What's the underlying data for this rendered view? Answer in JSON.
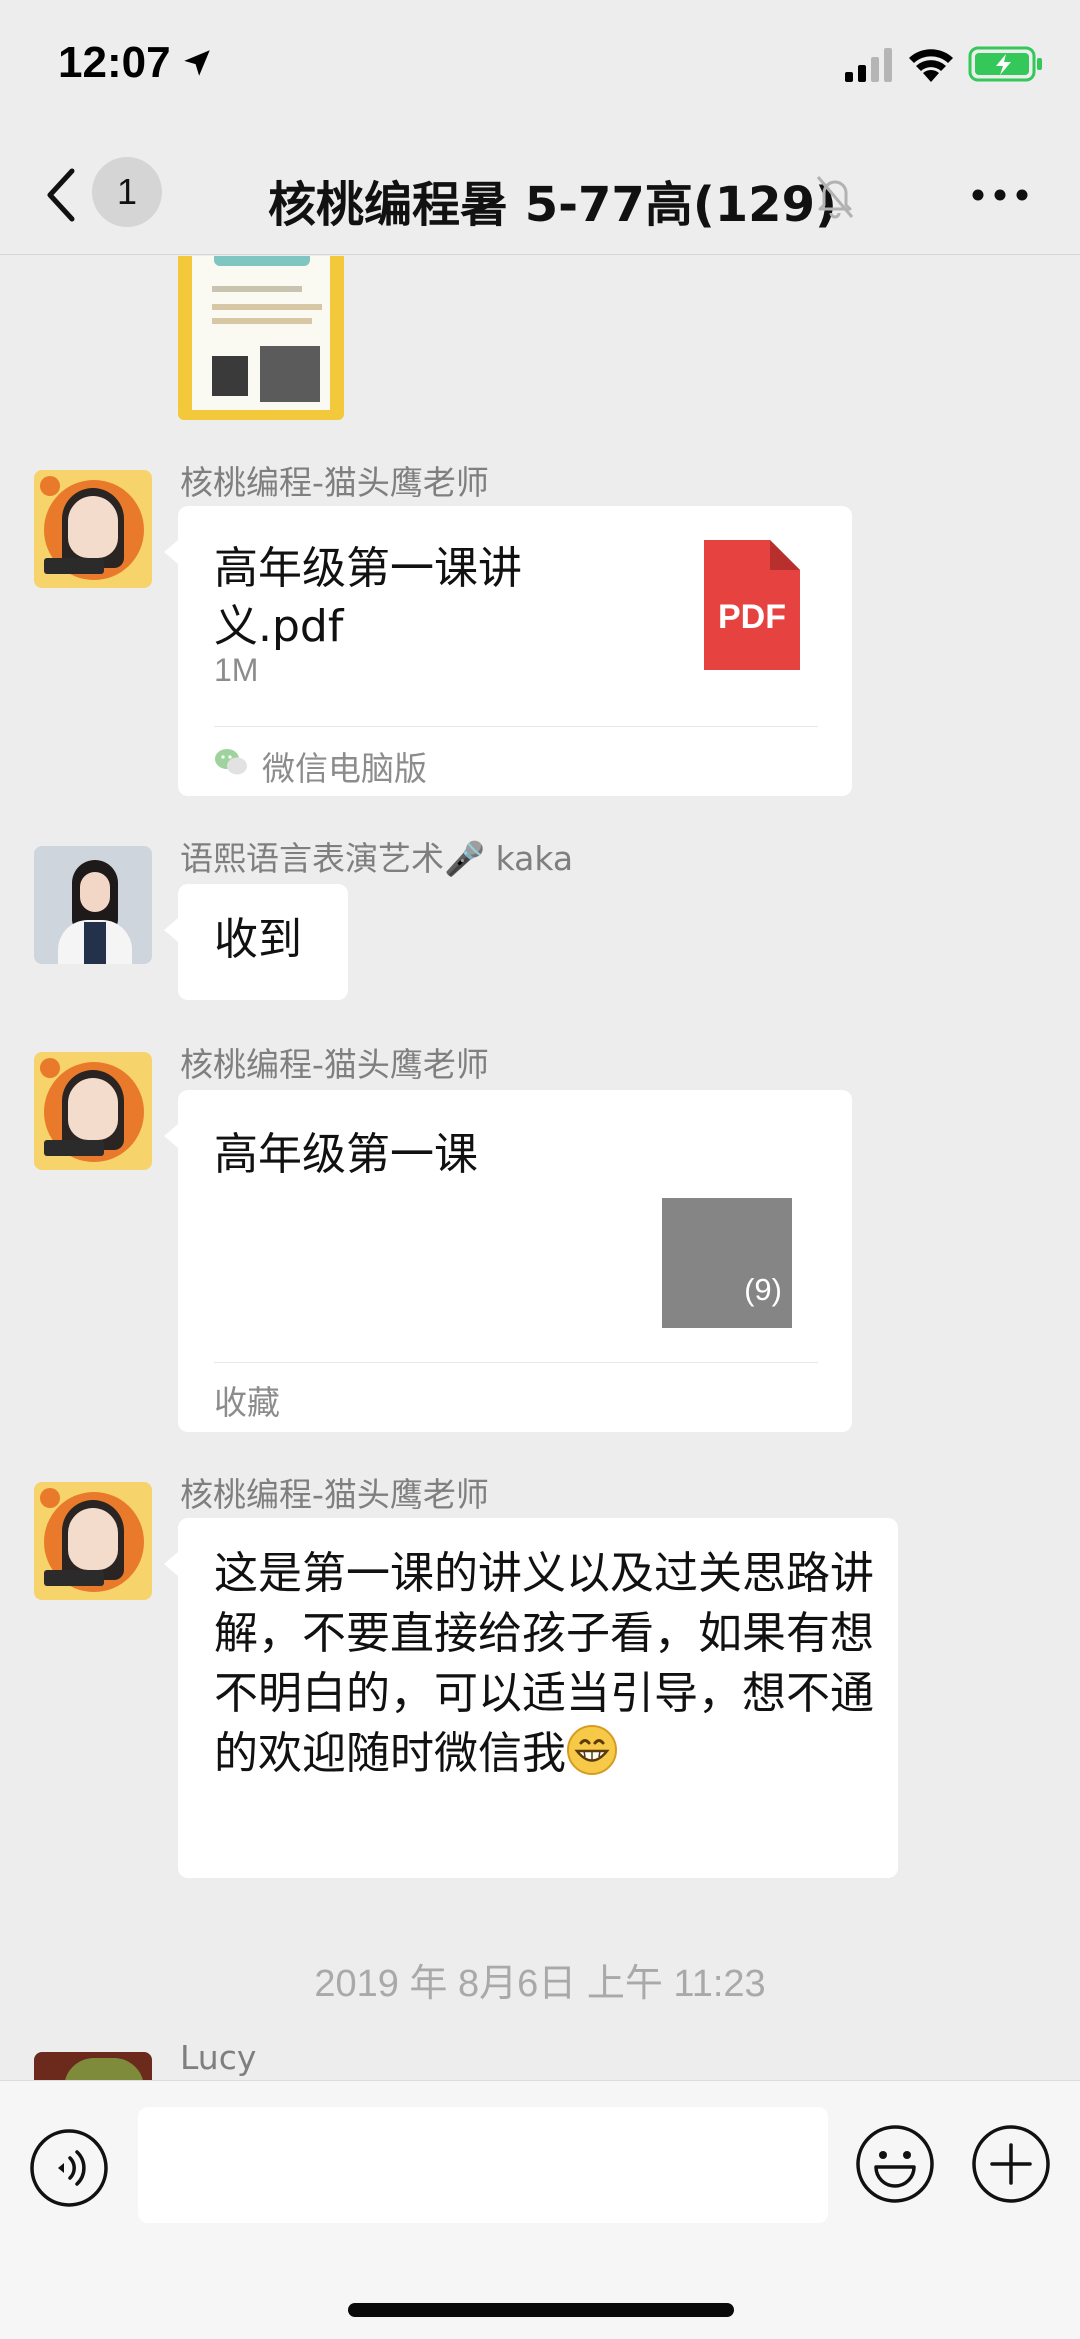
{
  "status": {
    "time": "12:07",
    "battery_color": "#34c759"
  },
  "header": {
    "unread_count": "1",
    "title": "核桃编程暑 5-77高(129)"
  },
  "messages": [
    {
      "type": "image",
      "sender": ""
    },
    {
      "type": "file",
      "sender": "核桃编程-猫头鹰老师",
      "file_name": "高年级第一课讲义.pdf",
      "file_size": "1M",
      "file_type": "PDF",
      "source": "微信电脑版"
    },
    {
      "type": "text",
      "sender": "语熙语言表演艺术🎤 kaka",
      "text": "收到"
    },
    {
      "type": "favorite",
      "sender": "核桃编程-猫头鹰老师",
      "title": "高年级第一课",
      "count": "(9)",
      "label": "收藏"
    },
    {
      "type": "text",
      "sender": "核桃编程-猫头鹰老师",
      "text": "这是第一课的讲义以及过关思路讲解，不要直接给孩子看，如果有想不明白的，可以适当引导，想不通的欢迎随时微信我"
    }
  ],
  "timestamp": "2019 年 8月6日 上午 11:23",
  "last_sender": "Lucy",
  "input": {
    "value": "",
    "placeholder": ""
  },
  "colors": {
    "background": "#ededed",
    "bubble": "#ffffff",
    "pdf_red": "#e64340",
    "name_gray": "#7f7f7f"
  },
  "icons": {
    "back": "chevron-left-icon",
    "mute": "bell-slash-icon",
    "more": "more-dots-icon",
    "voice": "voice-icon",
    "emoji": "smile-icon",
    "plus": "plus-circle-icon"
  }
}
